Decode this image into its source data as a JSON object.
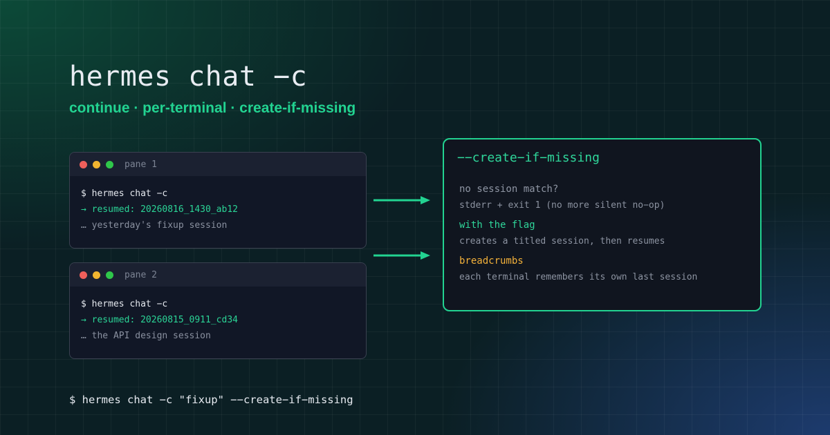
{
  "header": {
    "title": "hermes chat −c",
    "subtitle": "continue · per-terminal · create-if-missing"
  },
  "panes": [
    {
      "label": "pane 1",
      "command": "$ hermes chat −c",
      "resumed": "→ resumed: 20260816_1430_ab12",
      "note": "… yesterday's fixup session"
    },
    {
      "label": "pane 2",
      "command": "$ hermes chat −c",
      "resumed": "→ resumed: 20260815_0911_cd34",
      "note": "… the API design session"
    }
  ],
  "info_box": {
    "title": "−−create−if−missing",
    "question": "no session match?",
    "question_desc": "stderr + exit 1 (no more silent no−op)",
    "flag_head": "with the flag",
    "flag_desc": "creates a titled session, then resumes",
    "breadcrumbs_head": "breadcrumbs",
    "breadcrumbs_desc": "each terminal remembers its own last session"
  },
  "footer": {
    "command": "$ hermes chat −c \"fixup\" −−create−if−missing"
  },
  "colors": {
    "accent_green": "#22d391",
    "accent_amber": "#f3b13a",
    "dot_red": "#ef5f5b",
    "dot_yellow": "#f2b530",
    "dot_green": "#2fc74a"
  }
}
